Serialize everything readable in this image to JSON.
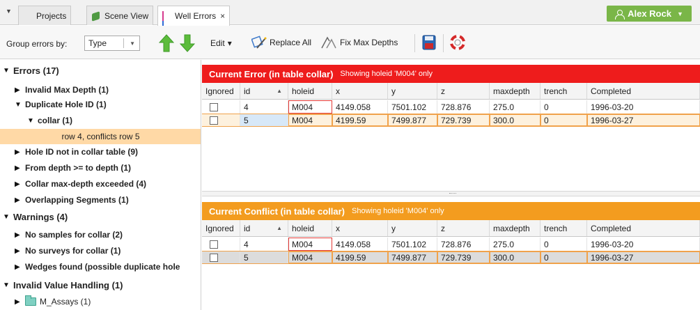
{
  "tabs": {
    "projects": "Projects",
    "scene_view": "Scene View",
    "well_errors": "Well Errors",
    "close_glyph": "×",
    "menu_glyph": "▼"
  },
  "user": {
    "name": "Alex Rock",
    "caret": "▼"
  },
  "toolbar": {
    "group_label": "Group errors by:",
    "group_value": "Type",
    "edit_label": "Edit",
    "edit_caret": "▾",
    "replace_all": "Replace All",
    "fix_max_depths": "Fix Max Depths"
  },
  "tree": {
    "errors": "Errors (17)",
    "invalid_max_depth": "Invalid Max Depth (1)",
    "duplicate_hole_id": "Duplicate Hole ID (1)",
    "collar": "collar (1)",
    "selected_row": "row 4, conflicts row 5",
    "hole_id_not_in_collar": "Hole ID not in collar table (9)",
    "from_depth": "From depth >= to depth (1)",
    "collar_max_depth": "Collar max-depth exceeded (4)",
    "overlapping": "Overlapping Segments (1)",
    "warnings": "Warnings (4)",
    "no_samples": "No samples for collar (2)",
    "no_surveys": "No surveys for collar (1)",
    "wedges": "Wedges found (possible duplicate hole",
    "invalid_value": "Invalid Value Handling (1)",
    "m_assays": "M_Assays (1)"
  },
  "current_error": {
    "title": "Current Error (in table collar)",
    "subtitle": "Showing holeid 'M004' only"
  },
  "current_conflict": {
    "title": "Current Conflict (in table collar)",
    "subtitle": "Showing holeid 'M004' only"
  },
  "columns": [
    "Ignored",
    "id",
    "holeid",
    "x",
    "y",
    "z",
    "maxdepth",
    "trench",
    "Completed"
  ],
  "error_rows": [
    [
      "",
      "4",
      "M004",
      "4149.058",
      "7501.102",
      "728.876",
      "275.0",
      "0",
      "1996-03-20"
    ],
    [
      "",
      "5",
      "M004",
      "4199.59",
      "7499.877",
      "729.739",
      "300.0",
      "0",
      "1996-03-27"
    ]
  ],
  "conflict_rows": [
    [
      "",
      "4",
      "M004",
      "4149.058",
      "7501.102",
      "728.876",
      "275.0",
      "0",
      "1996-03-20"
    ],
    [
      "",
      "5",
      "M004",
      "4199.59",
      "7499.877",
      "729.739",
      "300.0",
      "0",
      "1996-03-27"
    ]
  ],
  "colors": {
    "error_header": "#ee1c1c",
    "conflict_header": "#f39c1f",
    "user_button": "#7ab648",
    "selected_tree_row": "#ffd9a6",
    "selected_grid_row": "#fdf1de",
    "conflict_selected_row": "#dcdcdc"
  },
  "icons": {
    "projects": "grid-icon",
    "scene_view": "cube-icon",
    "well_errors": "well-bars-icon",
    "up": "green-up-arrow-icon",
    "down": "green-down-arrow-icon",
    "replace_all": "replace-wand-icon",
    "fix_max_depths": "fix-depth-icon",
    "save": "floppy-disk-icon",
    "help": "lifebuoy-icon"
  }
}
